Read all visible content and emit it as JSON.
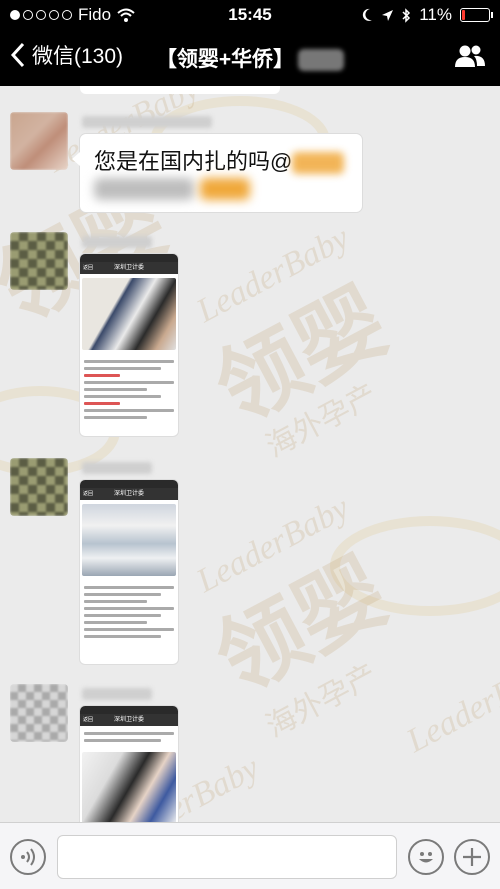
{
  "status_bar": {
    "carrier": "Fido",
    "time": "15:45",
    "battery": "11%",
    "signal_dots_filled": 1,
    "signal_dots_total": 5,
    "battery_level": 0.11
  },
  "nav": {
    "back_label": "微信(130)",
    "title": "【领婴+华侨】",
    "people_icon": "people-icon"
  },
  "messages": [
    {
      "type": "text",
      "text": "您是在国内扎的吗@"
    },
    {
      "type": "image",
      "screen_title": "深圳卫计委",
      "screen_back": "返回"
    },
    {
      "type": "image",
      "screen_title": "深圳卫计委",
      "screen_back": "返回"
    },
    {
      "type": "image",
      "screen_title": "深圳卫计委",
      "screen_back": "返回"
    }
  ],
  "watermark": {
    "en": "LeaderBaby",
    "zh": "领婴",
    "sub": "海外孕产"
  },
  "input": {
    "voice_icon": "voice-icon",
    "emoji_icon": "emoji-icon",
    "plus_icon": "plus-icon",
    "placeholder": ""
  },
  "colors": {
    "nav_bg": "#000000",
    "chat_bg": "#ebebeb",
    "mention": "#f0a83a",
    "battery_low": "#ff3b30"
  }
}
